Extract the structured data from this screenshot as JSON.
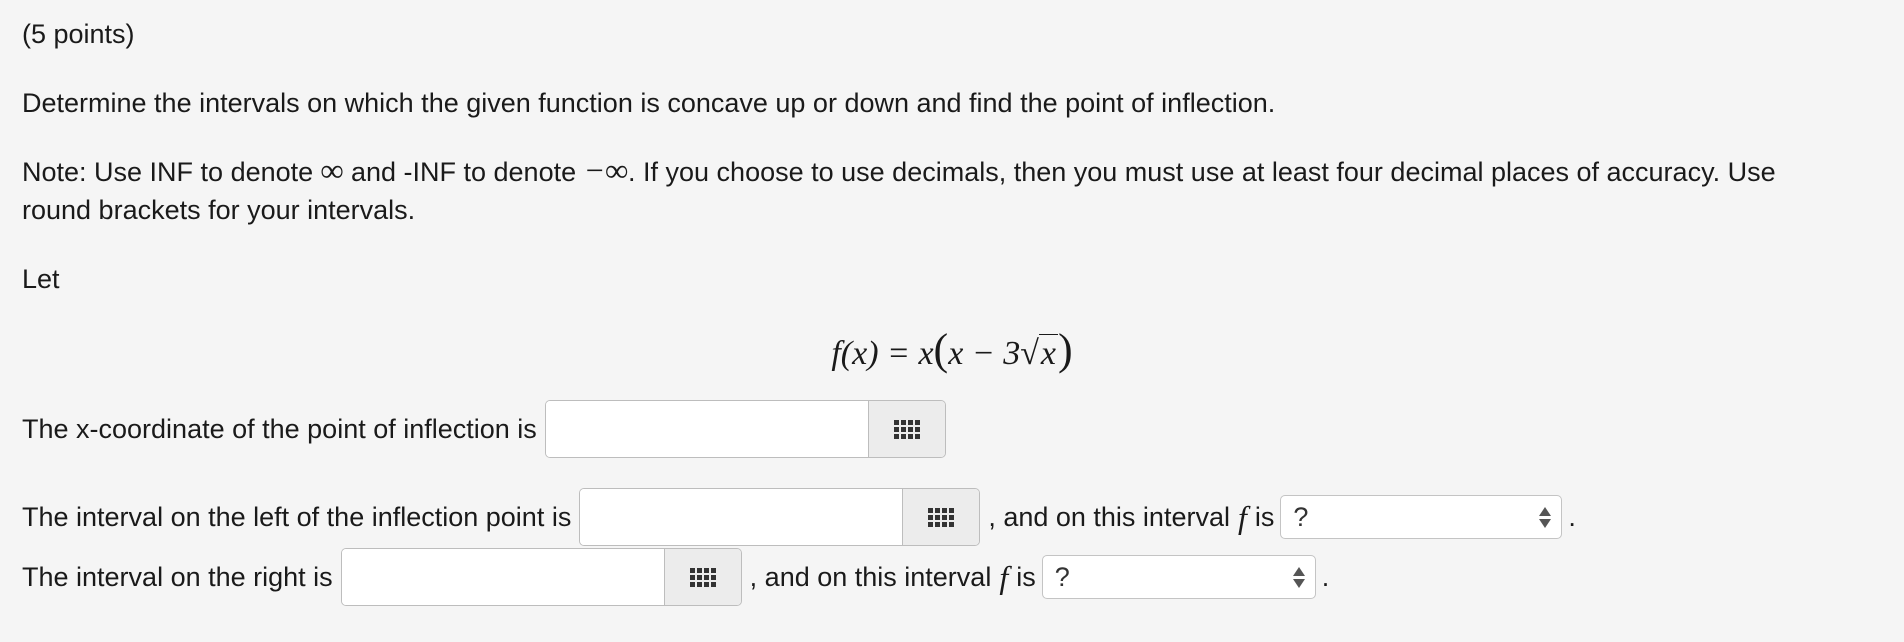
{
  "points": "(5 points)",
  "question": "Determine the intervals on which the given function is concave up or down and find the point of inflection.",
  "note": {
    "line1_a": "Note: Use INF to denote ",
    "infinity_symbol": "∞",
    "line1_b": " and -INF to denote ",
    "neg_infinity_symbol": "−∞",
    "line1_c": ". If you choose to use decimals, then you must use at least four decimal places of accuracy. Use",
    "line2": "round brackets for your intervals."
  },
  "let": "Let",
  "formula": {
    "lhs": "f(x) = x",
    "open": "(",
    "mid": "x − 3",
    "radical": "√",
    "radicand": "x",
    "close": ")"
  },
  "inflection": {
    "label": "The x-coordinate of the point of inflection is",
    "value": ""
  },
  "left_interval": {
    "label": "The interval on the left of the inflection point is",
    "value": "",
    "suffix": ", and on this interval",
    "f_symbol": "f",
    "is_text": "is",
    "select_value": "?",
    "end": "."
  },
  "right_interval": {
    "label": "The interval on the right is",
    "value": "",
    "suffix": ", and on this interval",
    "f_symbol": "f",
    "is_text": "is",
    "select_value": "?",
    "end": "."
  },
  "icons": {
    "math_palette": "grid-keypad-icon",
    "select_arrows": "updown-arrows-icon"
  }
}
